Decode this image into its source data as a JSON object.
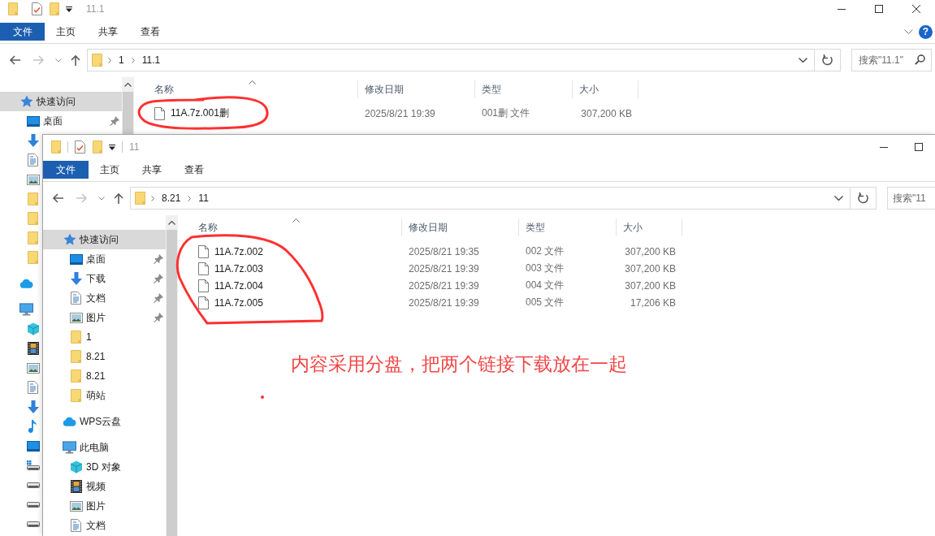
{
  "back_window": {
    "title": "11.1",
    "controls": [
      {
        "kind": "minimize"
      },
      {
        "kind": "maximize"
      },
      {
        "kind": "close"
      }
    ],
    "ribbon": {
      "file_menu": "文件",
      "tabs": [
        "主页",
        "共享",
        "查看"
      ],
      "buttons": [
        {
          "kind": "collapse"
        },
        {
          "kind": "help",
          "label": "?"
        }
      ]
    },
    "nav": [
      {
        "kind": "back",
        "disabled": false
      },
      {
        "kind": "forward",
        "disabled": true
      },
      {
        "kind": "recent",
        "disabled": false
      },
      {
        "kind": "up",
        "disabled": false
      }
    ],
    "address": {
      "path": [
        "1",
        "11.1"
      ]
    },
    "search": {
      "placeholder": "搜索\"11.1\""
    },
    "sidebar": [
      {
        "kind": "quick_access",
        "label": "快速访问",
        "selected": true,
        "children": [
          {
            "kind": "desktop",
            "label": "桌面",
            "selected": false,
            "pinned": true
          },
          {
            "kind": "downloads",
            "selected": false
          },
          {
            "kind": "documents",
            "selected": false
          },
          {
            "kind": "pictures",
            "selected": false
          },
          {
            "kind": "folder",
            "selected": false
          },
          {
            "kind": "folder",
            "selected": false
          },
          {
            "kind": "folder",
            "selected": false
          },
          {
            "kind": "folder",
            "selected": false
          }
        ]
      },
      {
        "kind": "cloud",
        "selected": false
      },
      {
        "kind": "computer",
        "selected": false,
        "children": [
          {
            "kind": "objects3d",
            "selected": false
          },
          {
            "kind": "videos",
            "selected": false
          },
          {
            "kind": "pictures",
            "selected": false
          },
          {
            "kind": "documents",
            "selected": false
          },
          {
            "kind": "downloads",
            "selected": false
          },
          {
            "kind": "music",
            "selected": false
          },
          {
            "kind": "desktop",
            "selected": false
          },
          {
            "kind": "system_drive",
            "selected": false
          },
          {
            "kind": "drive",
            "selected": false
          },
          {
            "kind": "drive",
            "selected": false
          },
          {
            "kind": "drive",
            "selected": false
          }
        ]
      }
    ],
    "columns": [
      {
        "label": "名称",
        "sorted": true
      },
      {
        "label": "修改日期",
        "sorted": false
      },
      {
        "label": "类型",
        "sorted": false
      },
      {
        "label": "大小",
        "sorted": false
      }
    ],
    "files": [
      {
        "name": "11A.7z.001删",
        "modified": "2025/8/21 19:39",
        "type": "001删 文件",
        "size": "307,200 KB"
      }
    ]
  },
  "front_window": {
    "title": "11",
    "controls": [
      {
        "kind": "minimize"
      },
      {
        "kind": "maximize"
      }
    ],
    "ribbon": {
      "file_menu": "文件",
      "tabs": [
        "主页",
        "共享",
        "查看"
      ]
    },
    "nav": [
      {
        "kind": "back",
        "disabled": false
      },
      {
        "kind": "forward",
        "disabled": true
      },
      {
        "kind": "recent",
        "disabled": false
      },
      {
        "kind": "up",
        "disabled": false
      }
    ],
    "address": {
      "path": [
        "8.21",
        "11"
      ]
    },
    "search": {
      "placeholder": "搜索\"11"
    },
    "sidebar": [
      {
        "kind": "quick_access",
        "label": "快速访问",
        "selected": true,
        "children": [
          {
            "kind": "desktop",
            "label": "桌面",
            "selected": false,
            "pinned": true
          },
          {
            "kind": "downloads",
            "label": "下载",
            "selected": false,
            "pinned": true
          },
          {
            "kind": "documents",
            "label": "文档",
            "selected": false,
            "pinned": true
          },
          {
            "kind": "pictures",
            "label": "图片",
            "selected": false,
            "pinned": true
          },
          {
            "kind": "folder",
            "label": "1",
            "selected": false,
            "pinned": false
          },
          {
            "kind": "folder",
            "label": "8.21",
            "selected": false,
            "pinned": false
          },
          {
            "kind": "folder",
            "label": "8.21",
            "selected": false,
            "pinned": false
          },
          {
            "kind": "folder",
            "label": "萌站",
            "selected": false,
            "pinned": false
          }
        ]
      },
      {
        "kind": "cloud",
        "label": "WPS云盘",
        "selected": false
      },
      {
        "kind": "computer",
        "label": "此电脑",
        "selected": false,
        "children": [
          {
            "kind": "objects3d",
            "label": "3D 对象",
            "selected": false
          },
          {
            "kind": "videos",
            "label": "视频",
            "selected": false
          },
          {
            "kind": "pictures",
            "label": "图片",
            "selected": false
          },
          {
            "kind": "documents",
            "label": "文档",
            "selected": false
          }
        ]
      }
    ],
    "columns": [
      {
        "label": "名称",
        "sorted": true
      },
      {
        "label": "修改日期",
        "sorted": false
      },
      {
        "label": "类型",
        "sorted": false
      },
      {
        "label": "大小",
        "sorted": false
      }
    ],
    "files": [
      {
        "name": "11A.7z.002",
        "modified": "2025/8/21 19:35",
        "type": "002 文件",
        "size": "307,200 KB"
      },
      {
        "name": "11A.7z.003",
        "modified": "2025/8/21 19:39",
        "type": "003 文件",
        "size": "307,200 KB"
      },
      {
        "name": "11A.7z.004",
        "modified": "2025/8/21 19:39",
        "type": "004 文件",
        "size": "307,200 KB"
      },
      {
        "name": "11A.7z.005",
        "modified": "2025/8/21 19:39",
        "type": "005 文件",
        "size": "17,206 KB"
      }
    ]
  },
  "annotations": {
    "note": "内容采用分盘，把两个链接下载放在一起"
  }
}
